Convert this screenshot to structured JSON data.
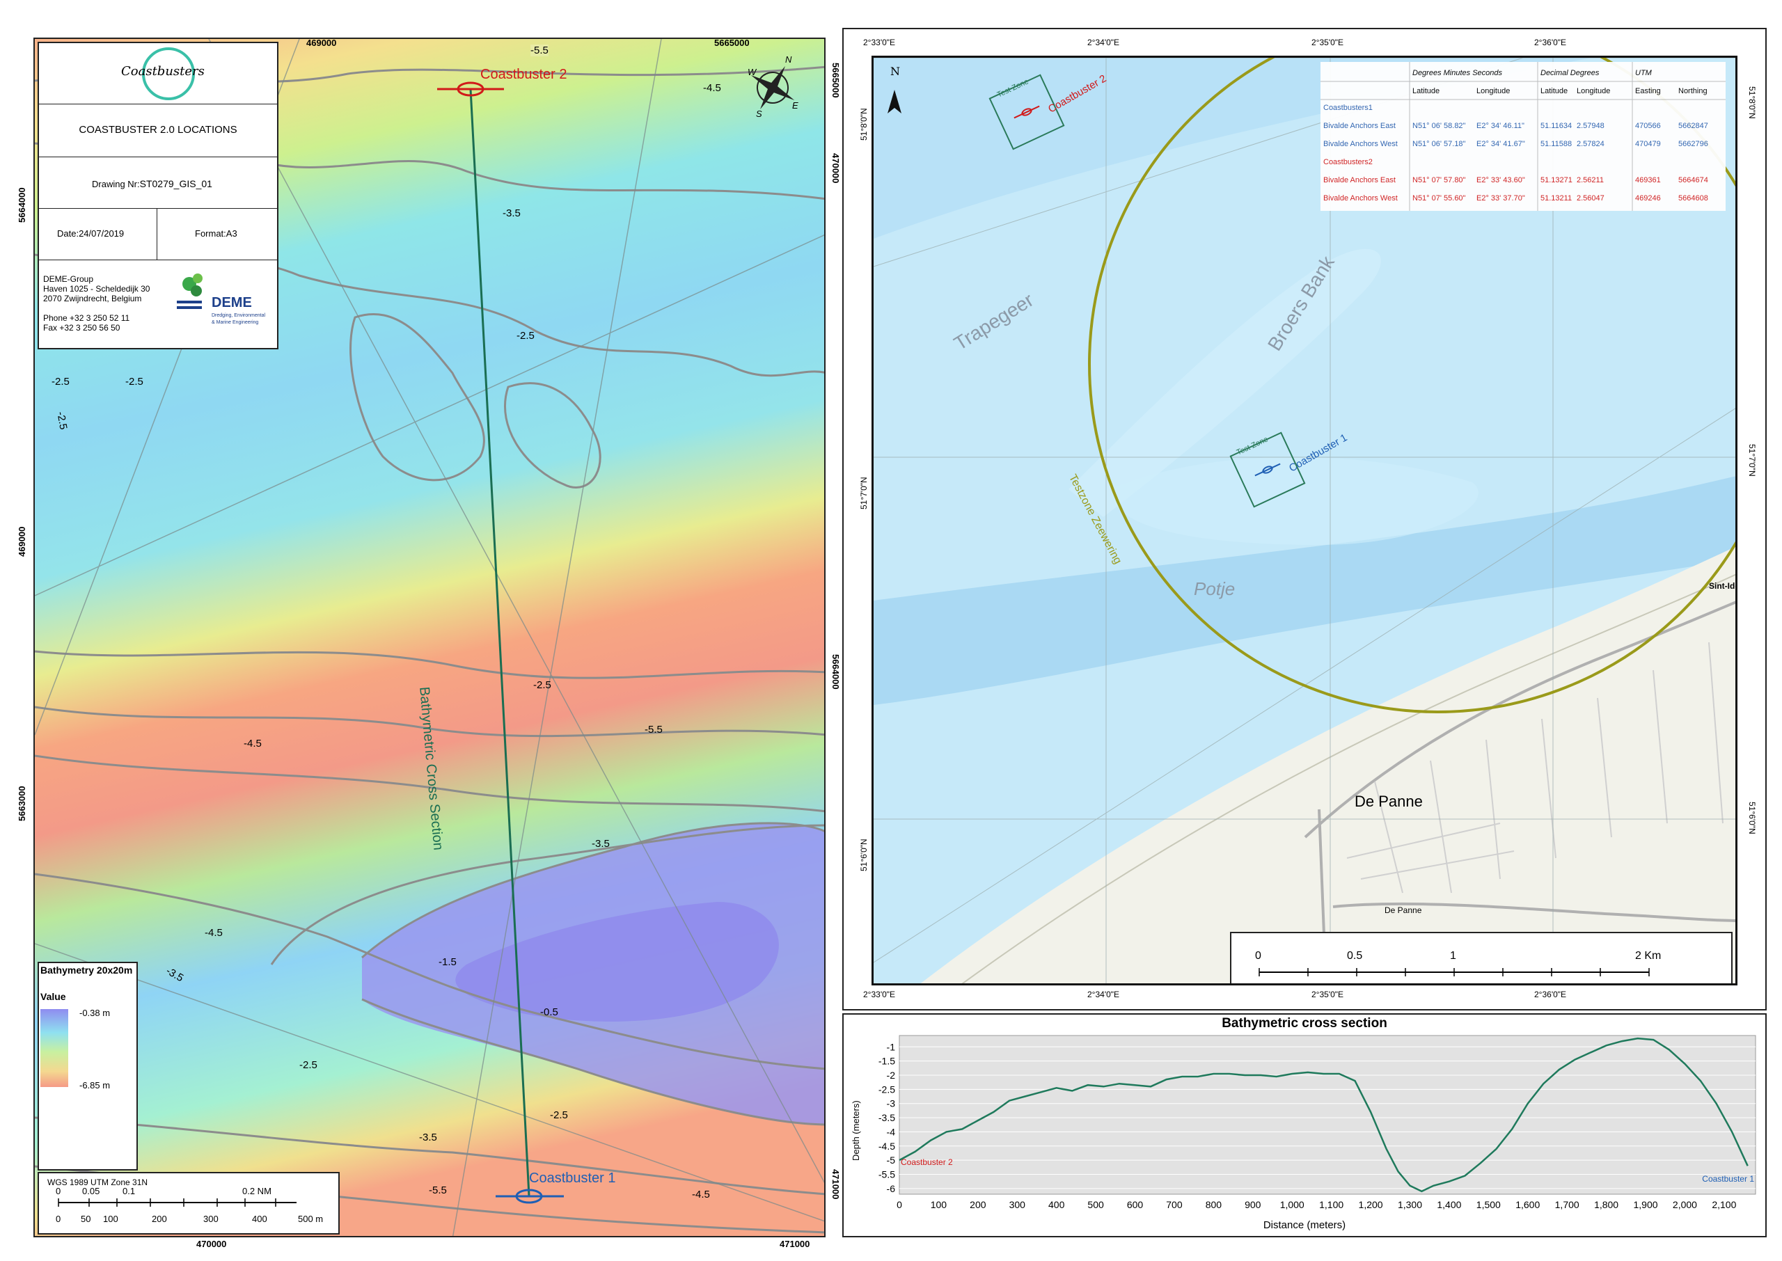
{
  "title_block": {
    "logo_text": "Coastbusters",
    "title": "COASTBUSTER 2.0 LOCATIONS",
    "drawing_label": "Drawing Nr:",
    "drawing_no": "ST0279_GIS_01",
    "date_label": "Date:",
    "date": "24/07/2019",
    "format_label": "Format:",
    "format": "A3",
    "company": [
      "DEME-Group",
      "Haven 1025 - Scheldedijk 30",
      "2070 Zwijndrecht, Belgium",
      "",
      "Phone +32 3 250 52 11",
      "Fax +32 3 250 56 50"
    ],
    "deme_logo": "DEME",
    "deme_tagline": [
      "Dredging, Environmental",
      "& Marine Engineering"
    ]
  },
  "left_map": {
    "colors": {
      "shallow": "#8f8cf0",
      "mid": "#8fe6f0",
      "deep": "#f59a86",
      "contour": "#8c8c8c",
      "section": "#1a6e52"
    },
    "top_ticks": [
      "469000",
      "5665000"
    ],
    "bottom_ticks": [
      "470000",
      "471000"
    ],
    "left_ticks": [
      "5664000",
      "469000",
      "5663000"
    ],
    "right_ticks": [
      "5665000",
      "470000",
      "5664000",
      "471000"
    ],
    "cb2_label": "Coastbuster 2",
    "cb1_label": "Coastbuster 1",
    "section_label": "Bathymetric Cross Section",
    "contour_labels": [
      "-5.5",
      "-4.5",
      "-3.5",
      "-2.5",
      "-2.5",
      "-2.5",
      "-2.5",
      "-2.5",
      "-5.5",
      "-4.5",
      "-3.5",
      "-4.5",
      "-3.5",
      "-1.5",
      "-0.5",
      "-2.5",
      "-2.5",
      "-3.5",
      "-5.5",
      "-4.5"
    ],
    "compass": {
      "n": "N",
      "s": "S",
      "w": "W",
      "e": "E"
    },
    "legend": {
      "title": "Bathymetry 20x20m",
      "value_label": "Value",
      "high": "-0.38 m",
      "low": "-6.85 m"
    },
    "scale": {
      "crs": "WGS 1989 UTM Zone 31N",
      "nm_ticks": [
        "0",
        "0.05",
        "0.1",
        "0.2 NM"
      ],
      "m_ticks": [
        "0",
        "50",
        "100",
        "200",
        "300",
        "400",
        "500 m"
      ]
    }
  },
  "right_map": {
    "colors": {
      "sea": "#c6e9f9",
      "channel": "#aadcf5",
      "land": "#f2f2ea",
      "circle": "#9a9a1a",
      "cb1": "#1f5fb4",
      "cb2": "#d11a1a",
      "zone": "#2a7a5a"
    },
    "top_ticks": [
      "2°33'0\"E",
      "2°34'0\"E",
      "2°35'0\"E",
      "2°36'0\"E"
    ],
    "bottom_ticks": [
      "2°33'0\"E",
      "2°34'0\"E",
      "2°35'0\"E",
      "2°36'0\"E"
    ],
    "left_ticks": [
      "51°8'0\"N",
      "51°7'0\"N",
      "51°6'0\"N"
    ],
    "right_ticks": [
      "51°8'0\"N",
      "51°7'0\"N",
      "51°6'0\"N"
    ],
    "north": "N",
    "places": {
      "trapegeer": "Trapegeer",
      "broers": "Broers Bank",
      "potje": "Potje",
      "testzone": "Testzone Zeewering",
      "depanne": "De Panne",
      "sint": "Sint-Idesba",
      "depanne_small": "De Panne"
    },
    "test_zone_label": "Test Zone",
    "cb2_label": "Coastbuster 2",
    "cb1_label": "Coastbuster 1",
    "table": {
      "group_headers": [
        "Degrees Minutes Seconds",
        "Decimal Degrees",
        "UTM"
      ],
      "sub_headers": [
        "Latitude",
        "Longitude",
        "Latitude",
        "Longitude",
        "Easting",
        "Northing"
      ],
      "rows": [
        {
          "label": "Coastbusters1",
          "cells": [
            "",
            "",
            "",
            "",
            "",
            ""
          ],
          "color": "blue"
        },
        {
          "label": "Bivalde Anchors East",
          "cells": [
            "N51° 06' 58.82\"",
            "E2° 34' 46.11\"",
            "51.11634",
            "2.57948",
            "470566",
            "5662847"
          ],
          "color": "blue"
        },
        {
          "label": "Bivalde Anchors West",
          "cells": [
            "N51° 06' 57.18\"",
            "E2° 34' 41.67\"",
            "51.11588",
            "2.57824",
            "470479",
            "5662796"
          ],
          "color": "blue"
        },
        {
          "label": "Coastbusters2",
          "cells": [
            "",
            "",
            "",
            "",
            "",
            ""
          ],
          "color": "red"
        },
        {
          "label": "Bivalde Anchors East",
          "cells": [
            "N51° 07' 57.80\"",
            "E2° 33' 43.60\"",
            "51.13271",
            "2.56211",
            "469361",
            "5664674"
          ],
          "color": "red"
        },
        {
          "label": "Bivalde Anchors West",
          "cells": [
            "N51° 07' 55.60\"",
            "E2° 33' 37.70\"",
            "51.13211",
            "2.56047",
            "469246",
            "5664608"
          ],
          "color": "red"
        }
      ]
    },
    "scale_ticks": [
      "0",
      "0.5",
      "1",
      "2 Km"
    ]
  },
  "chart_data": {
    "type": "line",
    "title": "Bathymetric cross section",
    "xlabel": "Distance (meters)",
    "ylabel": "Depth (meters)",
    "xlim": [
      0,
      2180
    ],
    "ylim": [
      -6.2,
      -0.6
    ],
    "xticks": [
      0,
      100,
      200,
      300,
      400,
      500,
      600,
      700,
      800,
      900,
      1000,
      1100,
      1200,
      1300,
      1400,
      1500,
      1600,
      1700,
      1800,
      1900,
      2000,
      2100
    ],
    "xtick_labels": [
      "0",
      "100",
      "200",
      "300",
      "400",
      "500",
      "600",
      "700",
      "800",
      "900",
      "1,000",
      "1,100",
      "1,200",
      "1,300",
      "1,400",
      "1,500",
      "1,600",
      "1,700",
      "1,800",
      "1,900",
      "2,000",
      "2,100"
    ],
    "yticks": [
      -1,
      -1.5,
      -2,
      -2.5,
      -3,
      -3.5,
      -4,
      -4.5,
      -5,
      -5.5,
      -6
    ],
    "ytick_labels": [
      "-1",
      "-1.5",
      "-2",
      "-2.5",
      "-3",
      "-3.5",
      "-4",
      "-4.5",
      "-5",
      "-5.5",
      "-6"
    ],
    "start_label": "Coastbuster 2",
    "end_label": "Coastbuster 1",
    "line_color": "#1f7a5c",
    "grid": true,
    "x": [
      0,
      40,
      80,
      120,
      160,
      200,
      240,
      280,
      320,
      360,
      400,
      440,
      480,
      520,
      560,
      600,
      640,
      680,
      720,
      760,
      800,
      840,
      880,
      920,
      960,
      1000,
      1040,
      1080,
      1120,
      1160,
      1200,
      1240,
      1270,
      1300,
      1330,
      1360,
      1400,
      1440,
      1480,
      1520,
      1560,
      1600,
      1640,
      1680,
      1720,
      1760,
      1800,
      1840,
      1880,
      1920,
      1960,
      2000,
      2040,
      2080,
      2120,
      2160
    ],
    "y": [
      -5.0,
      -4.7,
      -4.3,
      -4.0,
      -3.9,
      -3.6,
      -3.3,
      -2.9,
      -2.75,
      -2.6,
      -2.45,
      -2.55,
      -2.35,
      -2.4,
      -2.3,
      -2.35,
      -2.4,
      -2.15,
      -2.05,
      -2.05,
      -1.95,
      -1.95,
      -2.0,
      -2.0,
      -2.05,
      -1.95,
      -1.9,
      -1.95,
      -1.95,
      -2.2,
      -3.3,
      -4.6,
      -5.4,
      -5.9,
      -6.1,
      -5.9,
      -5.75,
      -5.55,
      -5.1,
      -4.6,
      -3.9,
      -3.0,
      -2.3,
      -1.8,
      -1.45,
      -1.2,
      -0.95,
      -0.8,
      -0.7,
      -0.75,
      -1.1,
      -1.6,
      -2.2,
      -3.0,
      -4.0,
      -5.2
    ]
  }
}
